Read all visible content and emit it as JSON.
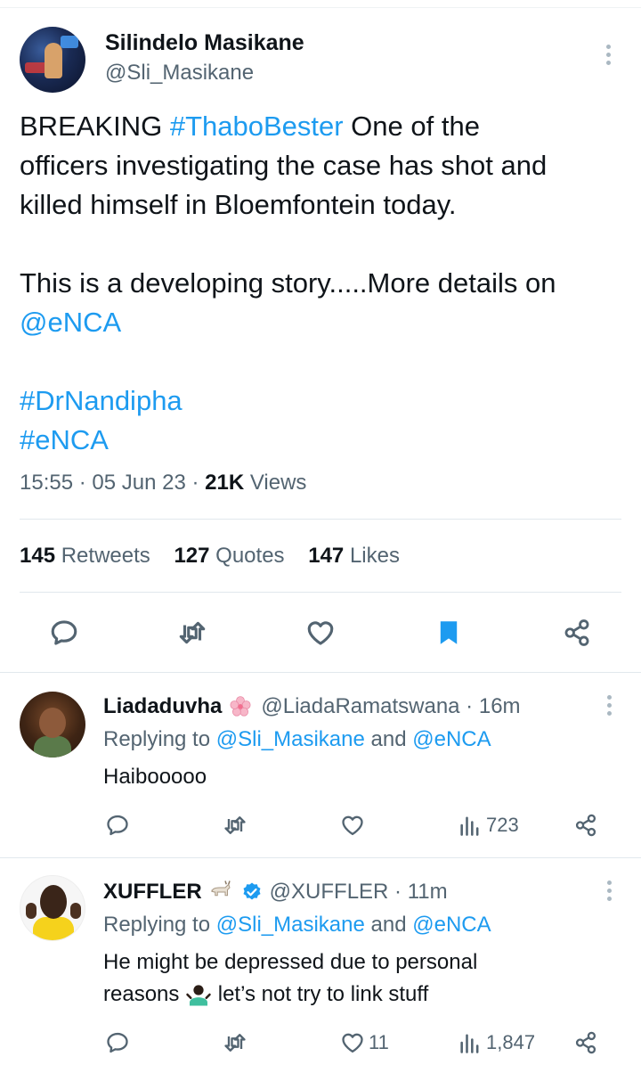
{
  "tweet": {
    "author_name": "Silindelo Masikane",
    "author_handle": "@Sli_Masikane",
    "text_lines": {
      "l1a": "BREAKING ",
      "l1b": "#ThaboBester",
      "l1c": " One of the",
      "l2": "officers investigating the case has shot and",
      "l3": "killed himself in Bloemfontein today.",
      "l4": "This is a developing story.....More details on",
      "l5": "@eNCA",
      "l6": "#DrNandipha",
      "l7": "#eNCA"
    },
    "time": "15:55",
    "date": "05 Jun 23",
    "views_count": "21K",
    "views_label": "Views",
    "retweets_count": "145",
    "retweets_label": "Retweets",
    "quotes_count": "127",
    "quotes_label": "Quotes",
    "likes_count": "147",
    "likes_label": "Likes",
    "bookmarked": true
  },
  "replies": [
    {
      "name": "Liadaduvha",
      "name_emoji": "cherry-blossom-icon",
      "handle": "@LiadaRamatswana",
      "time": "16m",
      "replying_prefix": "Replying to ",
      "replying_user1": "@Sli_Masikane",
      "replying_and": " and ",
      "replying_user2": "@eNCA",
      "body_l1": "Haibooooo",
      "body_l2": "",
      "likes": "",
      "views": "723"
    },
    {
      "name": "XUFFLER",
      "name_emoji": "goat-icon",
      "verified": true,
      "handle": "@XUFFLER",
      "time": "11m",
      "replying_prefix": "Replying to ",
      "replying_user1": "@Sli_Masikane",
      "replying_and": " and ",
      "replying_user2": "@eNCA",
      "body_l1": "He might be depressed due to personal",
      "body_l2a": "reasons ",
      "body_l2b": " let’s not try to link stuff",
      "likes": "11",
      "views": "1,847"
    }
  ],
  "colors": {
    "accent": "#1d9bf0",
    "text": "#0f1419",
    "muted": "#536471",
    "divider": "#e1e8ed"
  }
}
